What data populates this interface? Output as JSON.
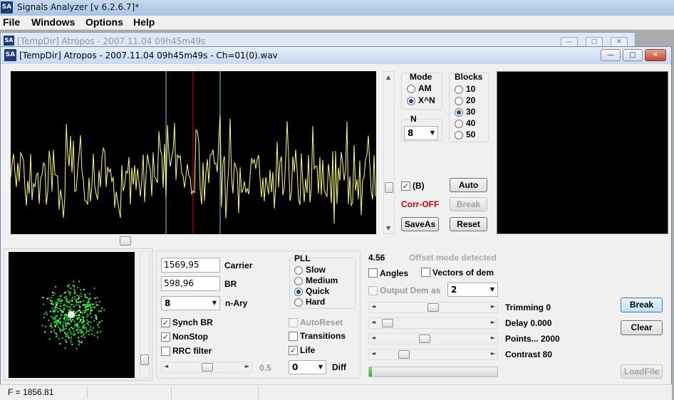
{
  "app": {
    "title": "Signals Analyzer [v 6.2.6.7]*",
    "icon": "SA"
  },
  "menu": [
    "File",
    "Windows",
    "Options",
    "Help"
  ],
  "bg_window": {
    "title": "[TempDir] Atropos - 2007.11.04 09h45m49s"
  },
  "child": {
    "title": "[TempDir] Atropos - 2007.11.04 09h45m49s - Ch=01(0).wav",
    "icon": "SA"
  },
  "window_buttons": {
    "minimize": "—",
    "maximize": "□",
    "close": "✕"
  },
  "mode": {
    "title": "Mode",
    "options": [
      "AM",
      "X^N"
    ],
    "selected": "X^N"
  },
  "n_group": {
    "title": "N",
    "value": "8"
  },
  "blocks": {
    "title": "Blocks",
    "options": [
      "10",
      "20",
      "30",
      "40",
      "50"
    ],
    "selected": "30"
  },
  "controls": {
    "b_label": "(B)",
    "b_checked": true,
    "corr": "Corr-OFF",
    "auto": "Auto",
    "break": "Break",
    "saveas": "SaveAs",
    "reset": "Reset"
  },
  "demod": {
    "carrier_value": "1569,95",
    "carrier_label": "Carrier",
    "br_value": "598,96",
    "br_label": "BR",
    "nary_value": "8",
    "nary_label": "n-Ary",
    "synch_br": "Synch BR",
    "nonstop": "NonStop",
    "rrc": "RRC filter",
    "autoreset": "AutoReset",
    "transitions": "Transitions",
    "life": "Life",
    "slider_value": "0.5",
    "diff_value": "0",
    "diff_label": "Diff"
  },
  "pll": {
    "title": "PLL",
    "options": [
      "Slow",
      "Medium",
      "Quick",
      "Hard"
    ],
    "selected": "Quick"
  },
  "offset": {
    "value": "4.56",
    "message": "Offset mode detected"
  },
  "angles": "Angles",
  "vectors": "Vectors of dem",
  "output_dem": {
    "label": "Output Dem as",
    "value": "2"
  },
  "sliders": {
    "trimming": "Trimming 0",
    "delay": "Delay  0.000",
    "points": "Points... 2000",
    "contrast": "Contrast 80"
  },
  "progress": 0.02,
  "right_buttons": {
    "break": "Break",
    "clear": "Clear",
    "loadfile": "LoadFile"
  },
  "status": {
    "freq": "F = 1856.81"
  },
  "colors": {
    "signal": "#ffff66",
    "marker_red": "#c00000",
    "marker_cyan": "#6ad0e0",
    "constellation": "#22dd22",
    "corr": "#cc0000"
  }
}
